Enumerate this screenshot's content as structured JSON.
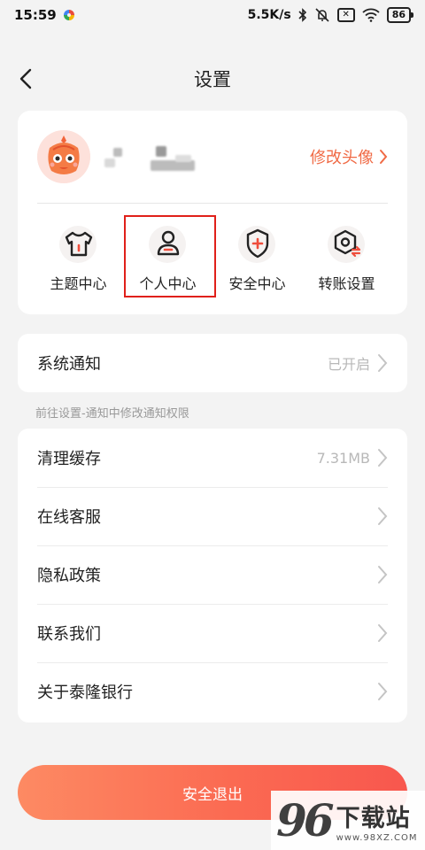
{
  "status_bar": {
    "time": "15:59",
    "network_speed": "5.5K/s",
    "battery": "86",
    "icons": [
      "app-dot-icon",
      "bluetooth-icon",
      "mute-icon",
      "x-box-icon",
      "wifi-icon",
      "battery-icon"
    ]
  },
  "header": {
    "title": "设置",
    "back_icon": "chevron-left-icon"
  },
  "profile": {
    "avatar_icon": "mascot-avatar",
    "edit_avatar_label": "修改头像",
    "accent_color": "#f06a45"
  },
  "shortcuts": [
    {
      "label": "主题中心",
      "icon": "tshirt-icon"
    },
    {
      "label": "个人中心",
      "icon": "user-icon",
      "highlighted": true
    },
    {
      "label": "安全中心",
      "icon": "shield-plus-icon"
    },
    {
      "label": "转账设置",
      "icon": "transfer-gear-icon"
    }
  ],
  "notification": {
    "label": "系统通知",
    "value": "已开启",
    "hint": "前往设置-通知中修改通知权限"
  },
  "settings_list": [
    {
      "label": "清理缓存",
      "value": "7.31MB"
    },
    {
      "label": "在线客服",
      "value": ""
    },
    {
      "label": "隐私政策",
      "value": ""
    },
    {
      "label": "联系我们",
      "value": ""
    },
    {
      "label": "关于泰隆银行",
      "value": ""
    }
  ],
  "logout": {
    "label": "安全退出"
  },
  "watermark": {
    "logo": "96",
    "title": "下载站",
    "url": "www.98XZ.COM"
  },
  "colors": {
    "highlight_border": "#e0201a",
    "logout_gradient_start": "#fd8a63",
    "logout_gradient_end": "#f8574e"
  }
}
